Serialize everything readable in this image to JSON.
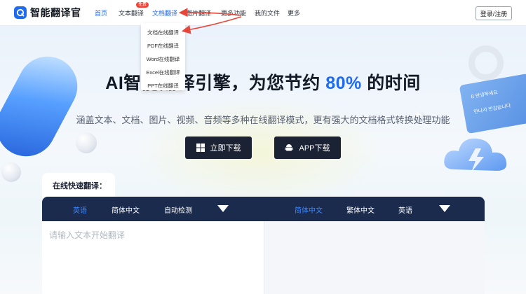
{
  "header": {
    "logo_text": "智能翻译官",
    "nav": [
      {
        "label": "首页",
        "active": true
      },
      {
        "label": "文本翻译",
        "active": false
      },
      {
        "label": "文档翻译",
        "active": true
      },
      {
        "label": "图片翻译",
        "active": false
      },
      {
        "label": "更多功能",
        "active": false
      },
      {
        "label": "我的文件",
        "active": false
      },
      {
        "label": "更多",
        "active": false
      }
    ],
    "badge": "免费",
    "login_label": "登录/注册"
  },
  "dropdown": {
    "items": [
      "文档在线翻译",
      "PDF在线翻译",
      "Word在线翻译",
      "Excel在线翻译",
      "PPT在线翻译"
    ]
  },
  "hero": {
    "title_before": "AI智能翻译引擎，为您节约 ",
    "title_accent": "80%",
    "title_after": " 的时间",
    "subtitle": "涵盖文本、文档、图片、视频、音频等多种在线翻译模式，更有强大的文档格式转换处理功能",
    "download_button": "立即下载",
    "app_button": "APP下载",
    "card_text_1": "ß 안녕하세요",
    "card_text_2": "만나서 반갑습니다"
  },
  "translator": {
    "tab_label": "在线快速翻译：",
    "source_langs": [
      "英语",
      "简体中文",
      "自动检测"
    ],
    "target_langs": [
      "简体中文",
      "繁体中文",
      "英语"
    ],
    "placeholder": "请输入文本开始翻译"
  },
  "colors": {
    "brand": "#1f6bf0",
    "bar": "#1b2b4d",
    "arrow": "#e5483a"
  }
}
